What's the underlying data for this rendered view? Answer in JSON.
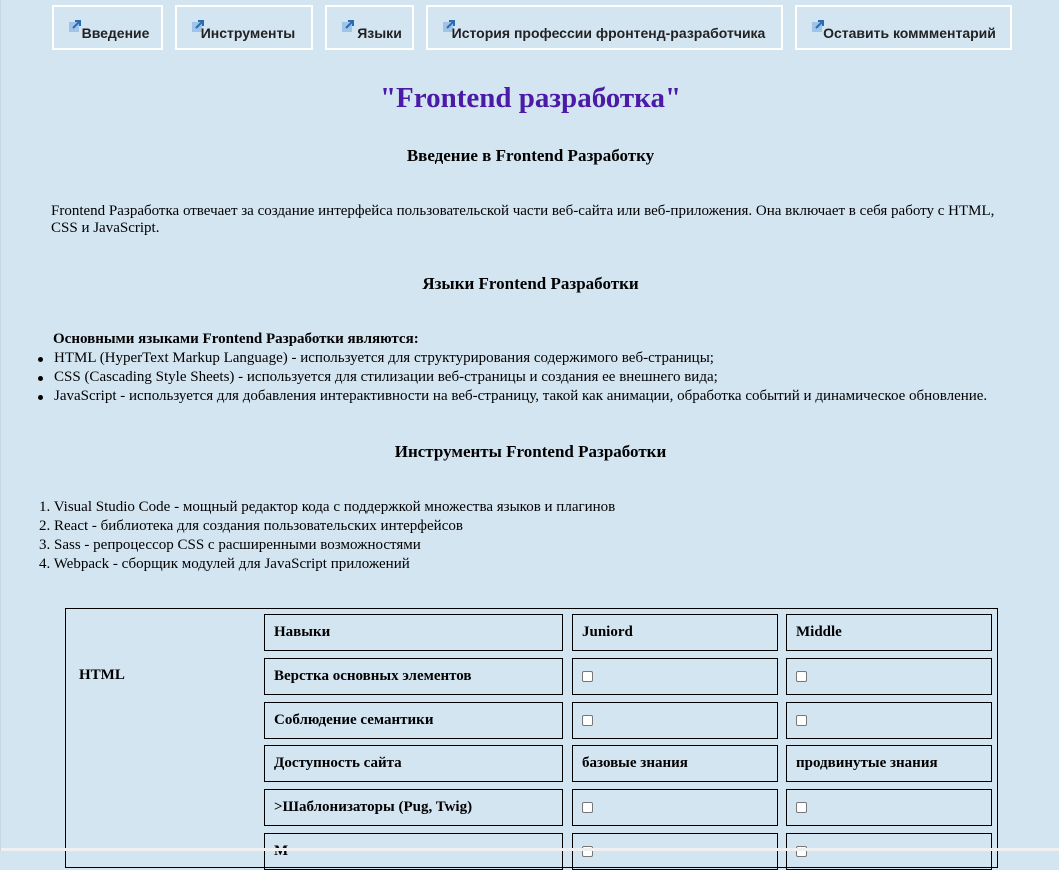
{
  "nav": {
    "items": [
      {
        "label": "Введение",
        "icon": "external-link-icon"
      },
      {
        "label": "Инструменты",
        "icon": "external-link-icon"
      },
      {
        "label": "Языки",
        "icon": "external-link-icon"
      },
      {
        "label": "История профессии фронтенд-разработчика",
        "icon": "external-link-icon"
      },
      {
        "label": "Оставить коммментарий",
        "icon": "external-link-icon"
      }
    ]
  },
  "title": "\"Frontend разработка\"",
  "intro": {
    "heading": "Введение в Frontend Разработку",
    "text": "Frontend Разработка отвечает за создание интерфейса пользовательской части веб-сайта или веб-приложения. Она включает в себя работу с HTML, CSS и JavaScript."
  },
  "languages": {
    "heading": "Языки Frontend Разработки",
    "lead": "Основными языками Frontend Разработки являются:",
    "items": [
      "HTML (HyperText Markup Language) - используется для структурирования содержимого веб-страницы;",
      "CSS (Cascading Style Sheets) - используется для стилизации веб-страницы и создания ее внешнего вида;",
      "JavaScript - используется для добавления интерактивности на веб-страницу, такой как анимации, обработка событий и динамическое обновление."
    ]
  },
  "tools": {
    "heading": "Инструменты Frontend Разработки",
    "items": [
      "1. Visual Studio Code - мощный редактор кода с поддержкой множества языков и плагинов",
      "2. React - библиотека для создания пользовательских интерфейсов",
      "3. Sass - репроцессор CSS с расширенными возможностями",
      "4. Webpack - сборщик модулей для JavaScript приложений"
    ]
  },
  "table": {
    "row_label": "HTML",
    "headers": {
      "skills": "Навыки",
      "junior": "Juniord",
      "middle": "Middle"
    },
    "rows": [
      {
        "skill": "Верстка основных элементов",
        "junior": "",
        "middle": ""
      },
      {
        "skill": "Соблюдение семантики",
        "junior": "",
        "middle": ""
      },
      {
        "skill": "Доступность сайта",
        "junior": "базовые знания",
        "middle": "продвинутые знания"
      },
      {
        "skill": ">Шаблонизаторы (Pug, Twig)",
        "junior": "",
        "middle": ""
      },
      {
        "skill": "М",
        "junior": "",
        "middle": ""
      }
    ]
  }
}
